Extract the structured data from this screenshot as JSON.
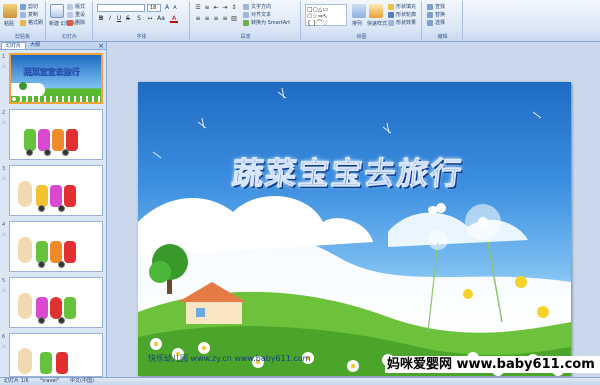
{
  "ribbon": {
    "clipboard": {
      "group_label": "剪贴板",
      "paste_label": "粘贴",
      "cut": "剪切",
      "copy": "复制",
      "format": "格式刷"
    },
    "slides": {
      "group_label": "幻灯片",
      "new_slide": "新建\n幻灯片",
      "layout": "版式",
      "reset": "重设",
      "delete": "删除"
    },
    "font": {
      "group_label": "字体",
      "font_name": "",
      "font_size": "18"
    },
    "paragraph": {
      "group_label": "段落",
      "text_direction": "文字方向",
      "align_text": "对齐文本",
      "smartart": "转换为 SmartArt"
    },
    "drawing": {
      "group_label": "绘图",
      "arrange": "排列",
      "quick_styles": "快速样式",
      "shape_fill": "形状填充",
      "shape_outline": "形状轮廓",
      "shape_effects": "形状效果"
    },
    "editing": {
      "group_label": "编辑",
      "find": "查找",
      "replace": "替换",
      "select": "选择"
    }
  },
  "pane": {
    "tabs": [
      "幻灯片",
      "大纲"
    ],
    "close_glyph": "×",
    "thumbnails": [
      {
        "number": "1",
        "title": "蔬菜宝宝去旅行",
        "selected": true
      },
      {
        "number": "2",
        "selected": false
      },
      {
        "number": "3",
        "selected": false
      },
      {
        "number": "4",
        "selected": false
      },
      {
        "number": "5",
        "selected": false
      },
      {
        "number": "6",
        "selected": false
      }
    ],
    "anim_glyph": "☆"
  },
  "slide": {
    "title": "蔬菜宝宝去旅行",
    "url_text": "快乐幼儿园 www.zy.cn www.baby611.com"
  },
  "status": {
    "slide_count": "幻灯片 1/6",
    "theme": "\"travel\"",
    "language": "中文(中国)"
  },
  "watermark": {
    "text": "妈咪爱婴网 www.baby611.com"
  },
  "colors": {
    "ribbon_bg": "#dbe7f6",
    "selection": "#f3a33b",
    "sky": "#3c8fe0",
    "grass": "#5cb82e"
  }
}
